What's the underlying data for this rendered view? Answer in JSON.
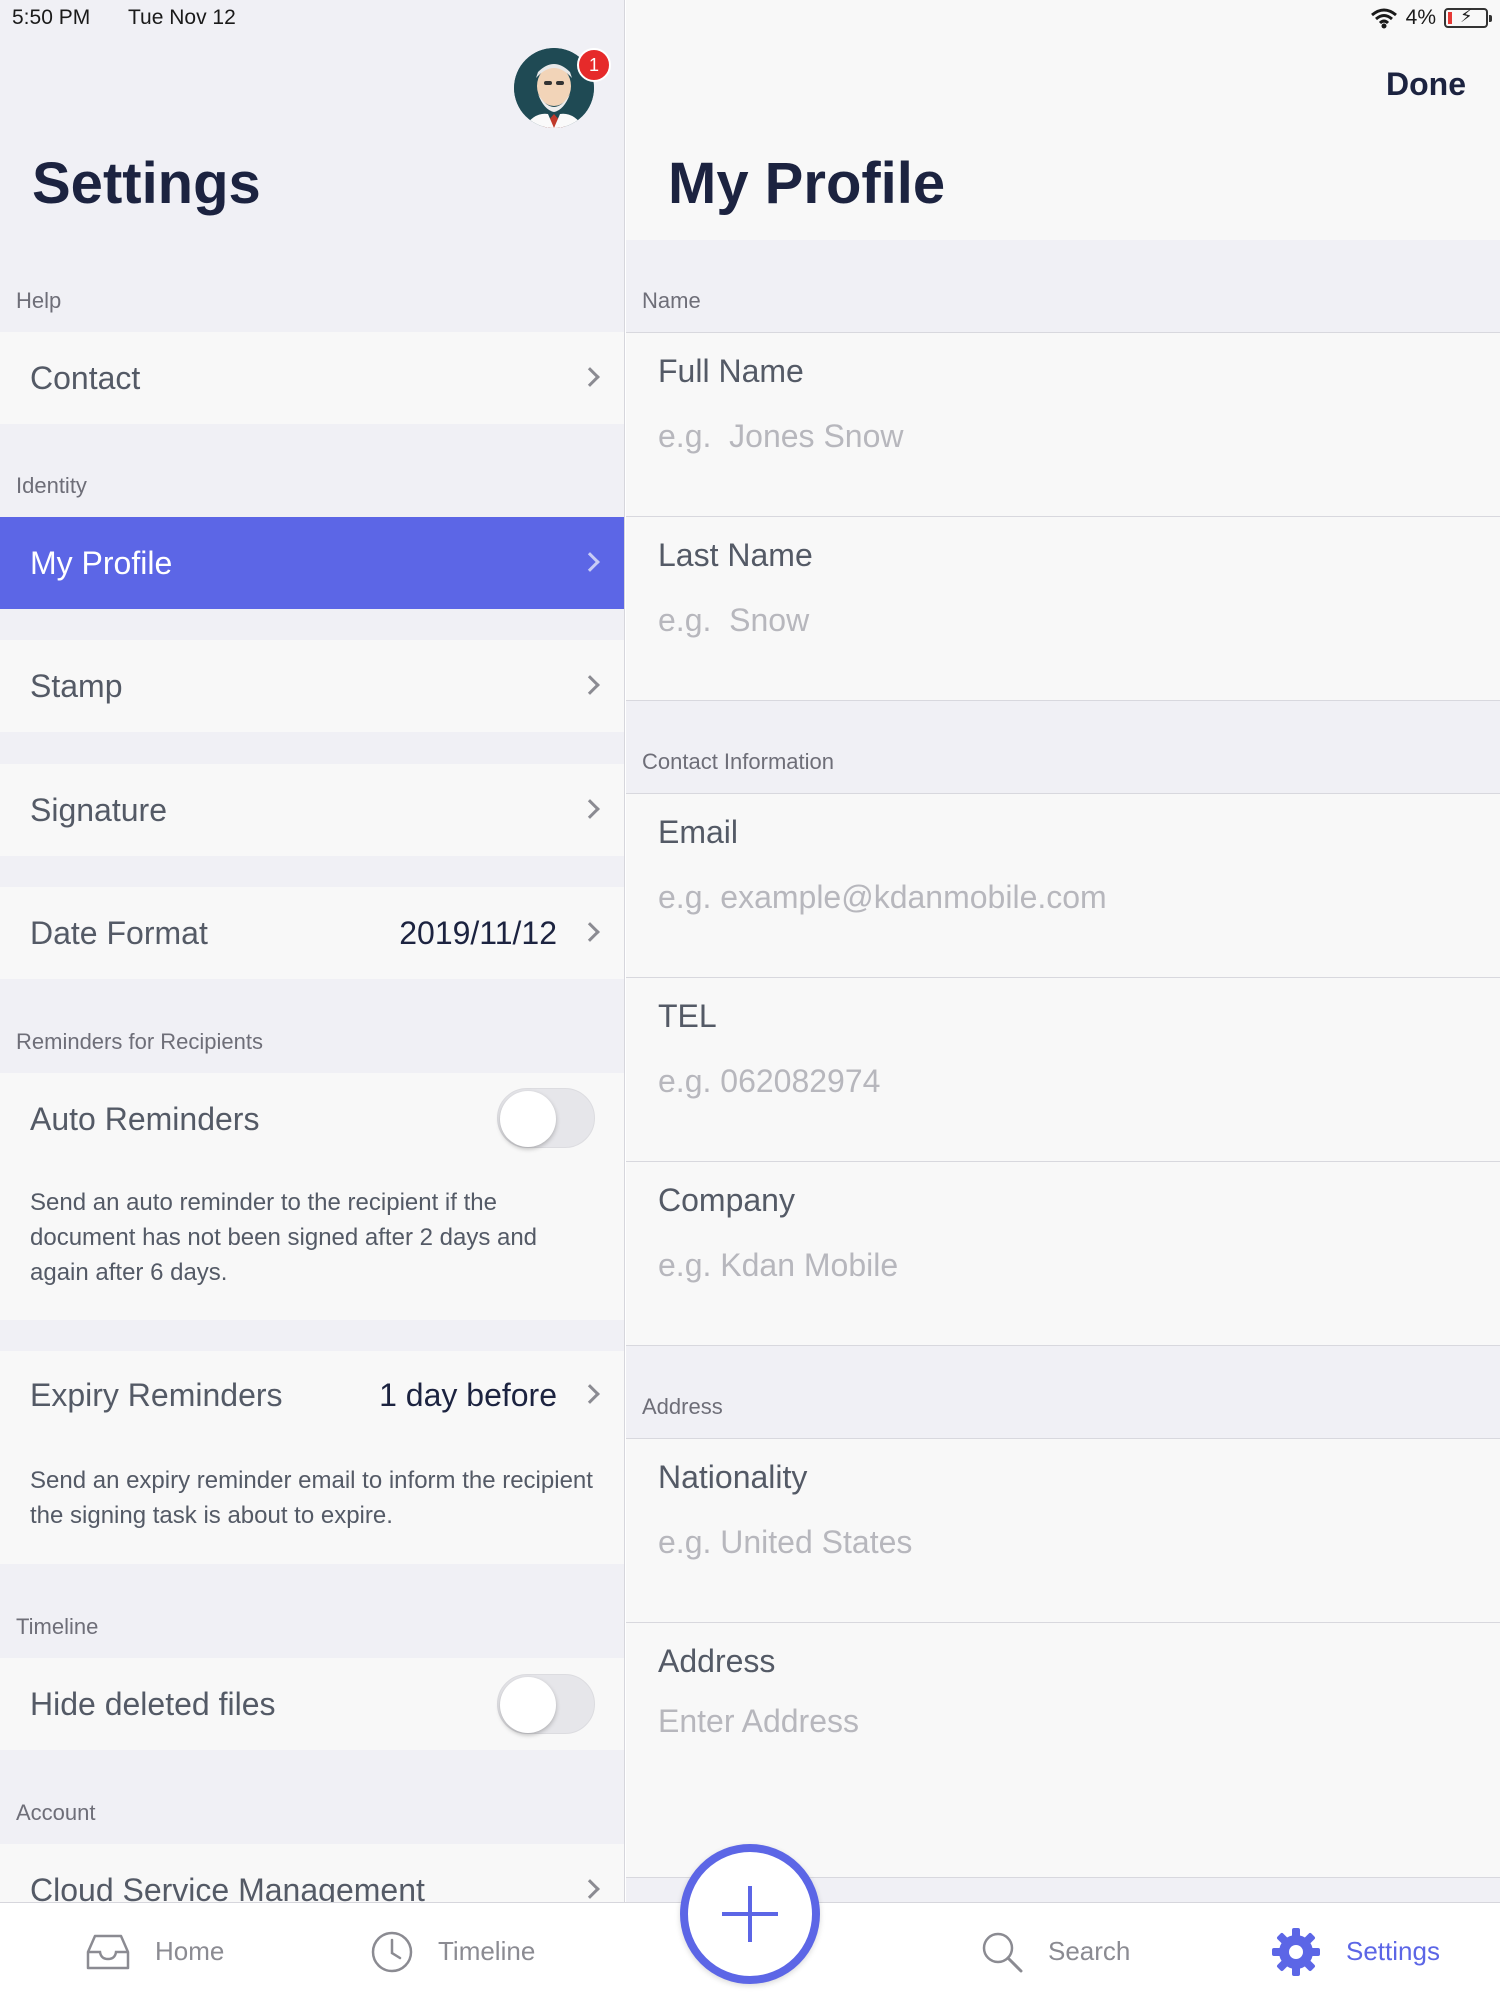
{
  "status_bar": {
    "time": "5:50 PM",
    "date": "Tue Nov 12",
    "battery": "4%",
    "icons": [
      "wifi-icon",
      "battery-charging-icon"
    ]
  },
  "left": {
    "title": "Settings",
    "avatar_badge": "1",
    "sections": {
      "help": "Help",
      "identity": "Identity",
      "reminders": "Reminders for Recipients",
      "timeline": "Timeline",
      "account": "Account"
    },
    "rows": {
      "contact": "Contact",
      "my_profile": "My Profile",
      "stamp": "Stamp",
      "signature": "Signature",
      "date_format": "Date Format",
      "date_format_value": "2019/11/12",
      "auto_reminders": "Auto Reminders",
      "auto_reminders_desc": "Send an auto reminder to the recipient if the document has not been signed after 2 days and again after 6 days.",
      "expiry_reminders": "Expiry Reminders",
      "expiry_reminders_value": "1 day before",
      "expiry_reminders_desc": "Send an expiry reminder email to inform the recipient the signing task is about to expire.",
      "hide_deleted": "Hide deleted files",
      "cloud_service": "Cloud Service Management"
    },
    "toggles": {
      "auto_reminders": false,
      "hide_deleted": false
    }
  },
  "right": {
    "title": "My Profile",
    "done_label": "Done",
    "sections": {
      "name": "Name",
      "contact": "Contact Information",
      "address": "Address"
    },
    "fields": {
      "full_name": {
        "label": "Full Name",
        "placeholder": "e.g.  Jones Snow"
      },
      "last_name": {
        "label": "Last Name",
        "placeholder": "e.g.  Snow"
      },
      "email": {
        "label": "Email",
        "placeholder": "e.g. example@kdanmobile.com"
      },
      "tel": {
        "label": "TEL",
        "placeholder": "e.g. 062082974"
      },
      "company": {
        "label": "Company",
        "placeholder": "e.g. Kdan Mobile"
      },
      "nationality": {
        "label": "Nationality",
        "placeholder": "e.g. United States"
      },
      "address": {
        "label": "Address",
        "placeholder": "Enter Address"
      }
    }
  },
  "tab_bar": {
    "home": "Home",
    "timeline": "Timeline",
    "search": "Search",
    "settings": "Settings",
    "active": "settings",
    "accent_color": "#5c66e6"
  }
}
